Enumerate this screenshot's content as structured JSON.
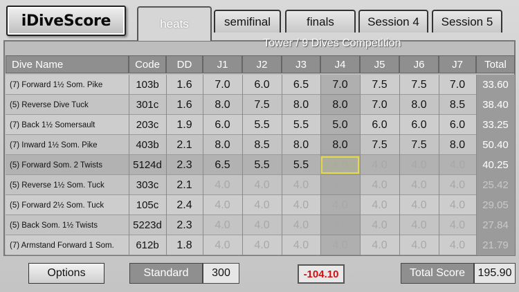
{
  "app": {
    "logo": "iDiveScore"
  },
  "tabs": [
    {
      "label": "heats",
      "active": true
    },
    {
      "label": "semifinal",
      "active": false
    },
    {
      "label": "finals",
      "active": false
    },
    {
      "label": "Session 4",
      "active": false
    },
    {
      "label": "Session 5",
      "active": false
    }
  ],
  "competition_title": "Tower / 9 Dives Competition",
  "columns": [
    "Dive Name",
    "Code",
    "DD",
    "J1",
    "J2",
    "J3",
    "J4",
    "J5",
    "J6",
    "J7",
    "Total"
  ],
  "rows": [
    {
      "name": "(7) Forward 1½ Som. Pike",
      "code": "103b",
      "dd": "1.6",
      "scores": [
        "7.0",
        "6.0",
        "6.5",
        "7.0",
        "7.5",
        "7.5",
        "7.0"
      ],
      "total": "33.60",
      "state": "scored"
    },
    {
      "name": "(5) Reverse Dive Tuck",
      "code": "301c",
      "dd": "1.6",
      "scores": [
        "8.0",
        "7.5",
        "8.0",
        "8.0",
        "7.0",
        "8.0",
        "8.5"
      ],
      "total": "38.40",
      "state": "scored"
    },
    {
      "name": "(7) Back 1½ Somersault",
      "code": "203c",
      "dd": "1.9",
      "scores": [
        "6.0",
        "5.5",
        "5.5",
        "5.0",
        "6.0",
        "6.0",
        "6.0"
      ],
      "total": "33.25",
      "state": "scored"
    },
    {
      "name": "(7) Inward 1½ Som. Pike",
      "code": "403b",
      "dd": "2.1",
      "scores": [
        "8.0",
        "8.5",
        "8.0",
        "8.0",
        "7.5",
        "7.5",
        "8.0"
      ],
      "total": "50.40",
      "state": "scored"
    },
    {
      "name": "(5) Forward Som. 2 Twists",
      "code": "5124d",
      "dd": "2.3",
      "scores": [
        "6.5",
        "5.5",
        "5.5",
        "4.0",
        "4.0",
        "4.0",
        "4.0"
      ],
      "scored_count": 3,
      "total": "40.25",
      "state": "current"
    },
    {
      "name": "(5) Reverse 1½ Som. Tuck",
      "code": "303c",
      "dd": "2.1",
      "scores": [
        "4.0",
        "4.0",
        "4.0",
        "4.0",
        "4.0",
        "4.0",
        "4.0"
      ],
      "total": "25.42",
      "state": "pending"
    },
    {
      "name": "(5) Forward 2½ Som. Tuck",
      "code": "105c",
      "dd": "2.4",
      "scores": [
        "4.0",
        "4.0",
        "4.0",
        "4.0",
        "4.0",
        "4.0",
        "4.0"
      ],
      "total": "29.05",
      "state": "pending"
    },
    {
      "name": "(5) Back Som. 1½ Twists",
      "code": "5223d",
      "dd": "2.3",
      "scores": [
        "4.0",
        "4.0",
        "4.0",
        "4.0",
        "4.0",
        "4.0",
        "4.0"
      ],
      "total": "27.84",
      "state": "pending"
    },
    {
      "name": "(7) Armstand Forward 1 Som.",
      "code": "612b",
      "dd": "1.8",
      "scores": [
        "4.0",
        "4.0",
        "4.0",
        "4.0",
        "4.0",
        "4.0",
        "4.0"
      ],
      "total": "21.79",
      "state": "pending"
    }
  ],
  "footer": {
    "options_label": "Options",
    "standard_label": "Standard",
    "standard_value": "300",
    "deduction": "-104.10",
    "total_score_label": "Total Score",
    "total_score_value": "195.90"
  },
  "colors": {
    "header": "#8f8f8f",
    "deduction": "#d01010",
    "selection": "#e5d84a"
  }
}
